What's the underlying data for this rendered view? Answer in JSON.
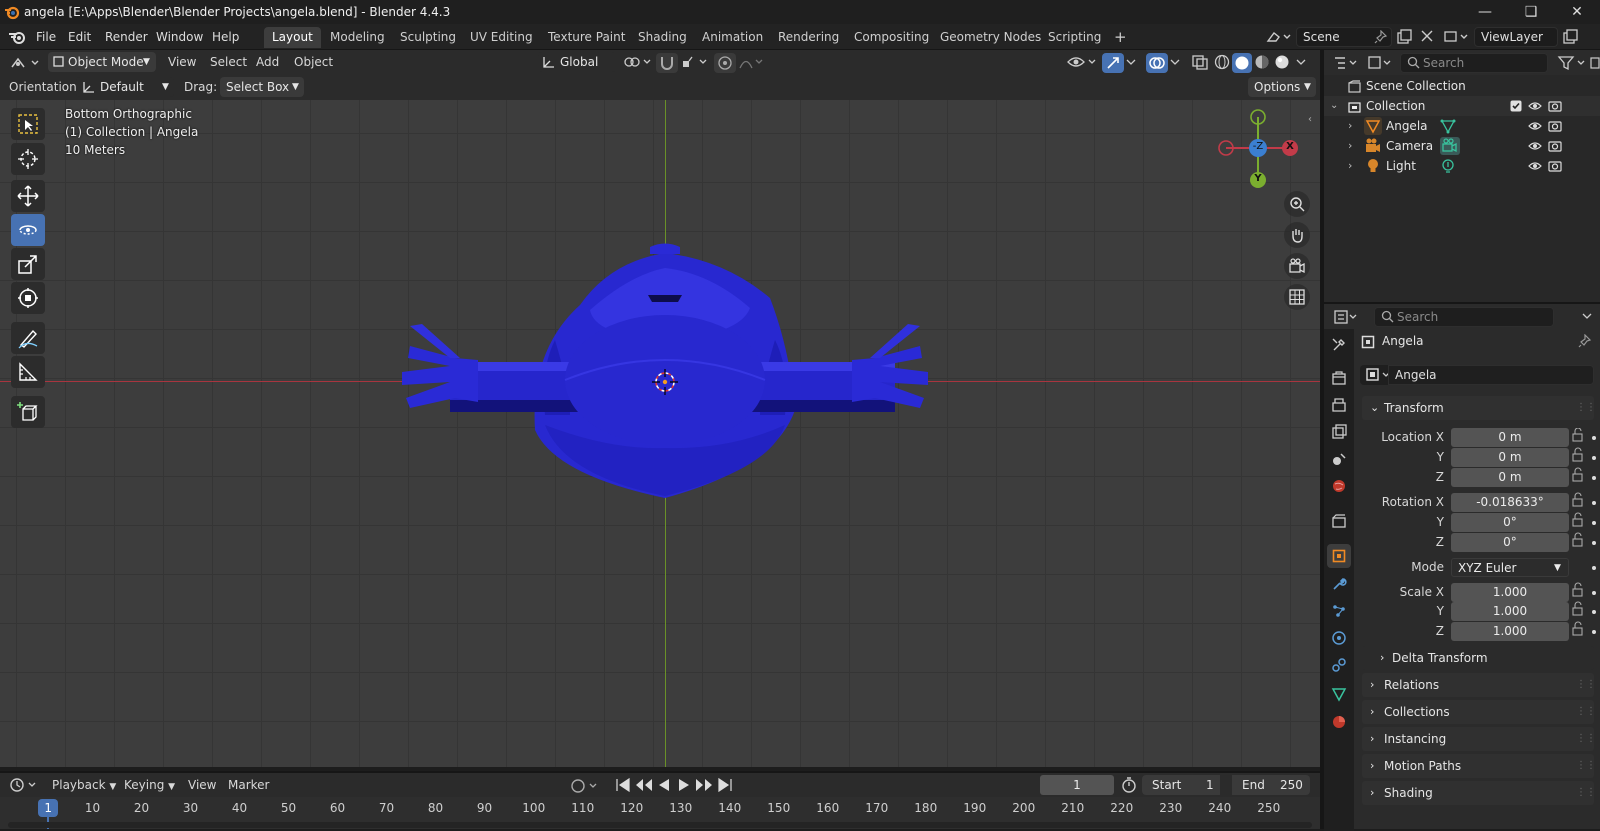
{
  "title_bar": {
    "title": "angela [E:\\Apps\\Blender\\Blender Projects\\angela.blend] - Blender 4.4.3"
  },
  "menu": [
    "File",
    "Edit",
    "Render",
    "Window",
    "Help"
  ],
  "workspaces": [
    "Layout",
    "Modeling",
    "Sculpting",
    "UV Editing",
    "Texture Paint",
    "Shading",
    "Animation",
    "Rendering",
    "Compositing",
    "Geometry Nodes",
    "Scripting"
  ],
  "active_workspace": "Layout",
  "scene": {
    "name": "Scene",
    "view_layer": "ViewLayer"
  },
  "viewport_header": {
    "mode": "Object Mode",
    "menus": [
      "View",
      "Select",
      "Add",
      "Object"
    ],
    "transform_orientation": "Global",
    "orientation_label": "Orientation:",
    "orientation_value": "Default",
    "drag_label": "Drag:",
    "drag_value": "Select Box",
    "options": "Options"
  },
  "viewport": {
    "view_name": "Bottom Orthographic",
    "collection_info": "(1) Collection | Angela",
    "scale": "10 Meters",
    "gizmo": {
      "neg_z": "-Z",
      "x": "X",
      "y": "Y"
    },
    "colors": {
      "mesh": "#2a2ad6",
      "x_axis": "#c23b49",
      "y_axis": "#7bae2f",
      "z_axis": "#3b7fd1"
    }
  },
  "outliner": {
    "search_placeholder": "Search",
    "root": "Scene Collection",
    "collection": "Collection",
    "items": [
      {
        "name": "Angela",
        "icon": "mesh-triangle-icon"
      },
      {
        "name": "Camera",
        "icon": "camera-icon"
      },
      {
        "name": "Light",
        "icon": "light-bulb-icon"
      }
    ]
  },
  "properties": {
    "search_placeholder": "Search",
    "object_name": "Angela",
    "object_field": "Angela",
    "transform_title": "Transform",
    "location": {
      "label": "Location X",
      "x": "0 m",
      "y": "0 m",
      "z": "0 m"
    },
    "rotation": {
      "label": "Rotation X",
      "x": "-0.018633°",
      "y": "0°",
      "z": "0°"
    },
    "mode_label": "Mode",
    "mode_value": "XYZ Euler",
    "scale": {
      "label": "Scale X",
      "x": "1.000",
      "y": "1.000",
      "z": "1.000"
    },
    "axis_y": "Y",
    "axis_z": "Z",
    "delta_transform": "Delta Transform",
    "sections": [
      "Relations",
      "Collections",
      "Instancing",
      "Motion Paths",
      "Shading"
    ]
  },
  "timeline": {
    "menus": [
      "Playback",
      "Keying",
      "View",
      "Marker"
    ],
    "current_frame": "1",
    "start_label": "Start",
    "start_value": "1",
    "end_label": "End",
    "end_value": "250",
    "ruler": [
      "1",
      "10",
      "20",
      "30",
      "40",
      "50",
      "60",
      "70",
      "80",
      "90",
      "100",
      "110",
      "120",
      "130",
      "140",
      "150",
      "160",
      "170",
      "180",
      "190",
      "200",
      "210",
      "220",
      "230",
      "240",
      "250"
    ]
  }
}
